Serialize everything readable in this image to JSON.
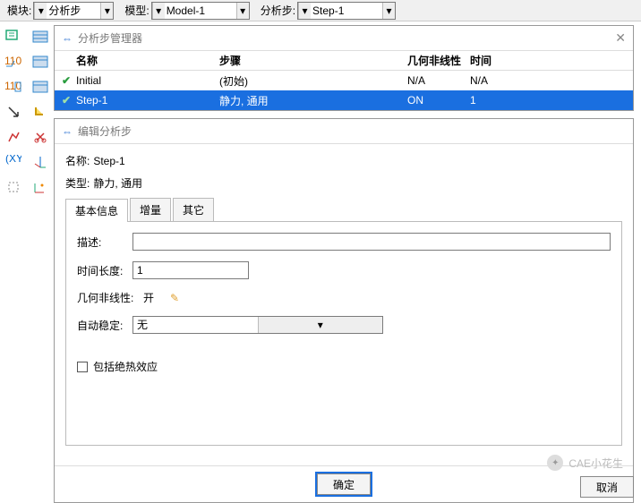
{
  "topbar": {
    "module_label": "模块:",
    "module_value": "分析步",
    "model_label": "模型:",
    "model_value": "Model-1",
    "step_label": "分析步:",
    "step_value": "Step-1"
  },
  "manager": {
    "title": "分析步管理器",
    "columns": {
      "name": "名称",
      "step": "步骤",
      "nonlinear": "几何非线性",
      "time": "时间"
    },
    "rows": [
      {
        "name": "Initial",
        "step": "(初始)",
        "nonlinear": "N/A",
        "time": "N/A",
        "selected": false
      },
      {
        "name": "Step-1",
        "step": "静力, 通用",
        "nonlinear": "ON",
        "time": "1",
        "selected": true
      }
    ]
  },
  "editor": {
    "title": "编辑分析步",
    "name_label": "名称:",
    "name_value": "Step-1",
    "type_label": "类型:",
    "type_value": "静力, 通用",
    "tabs": {
      "basic": "基本信息",
      "increment": "增量",
      "other": "其它"
    },
    "desc_label": "描述:",
    "desc_value": "",
    "timelen_label": "时间长度:",
    "timelen_value": "1",
    "nlgeom_label": "几何非线性:",
    "nlgeom_value": "开",
    "autostab_label": "自动稳定:",
    "autostab_value": "无",
    "adiabatic_label": "包括绝热效应",
    "ok": "确定",
    "cancel": "取消"
  },
  "watermark": "CAE小花生"
}
